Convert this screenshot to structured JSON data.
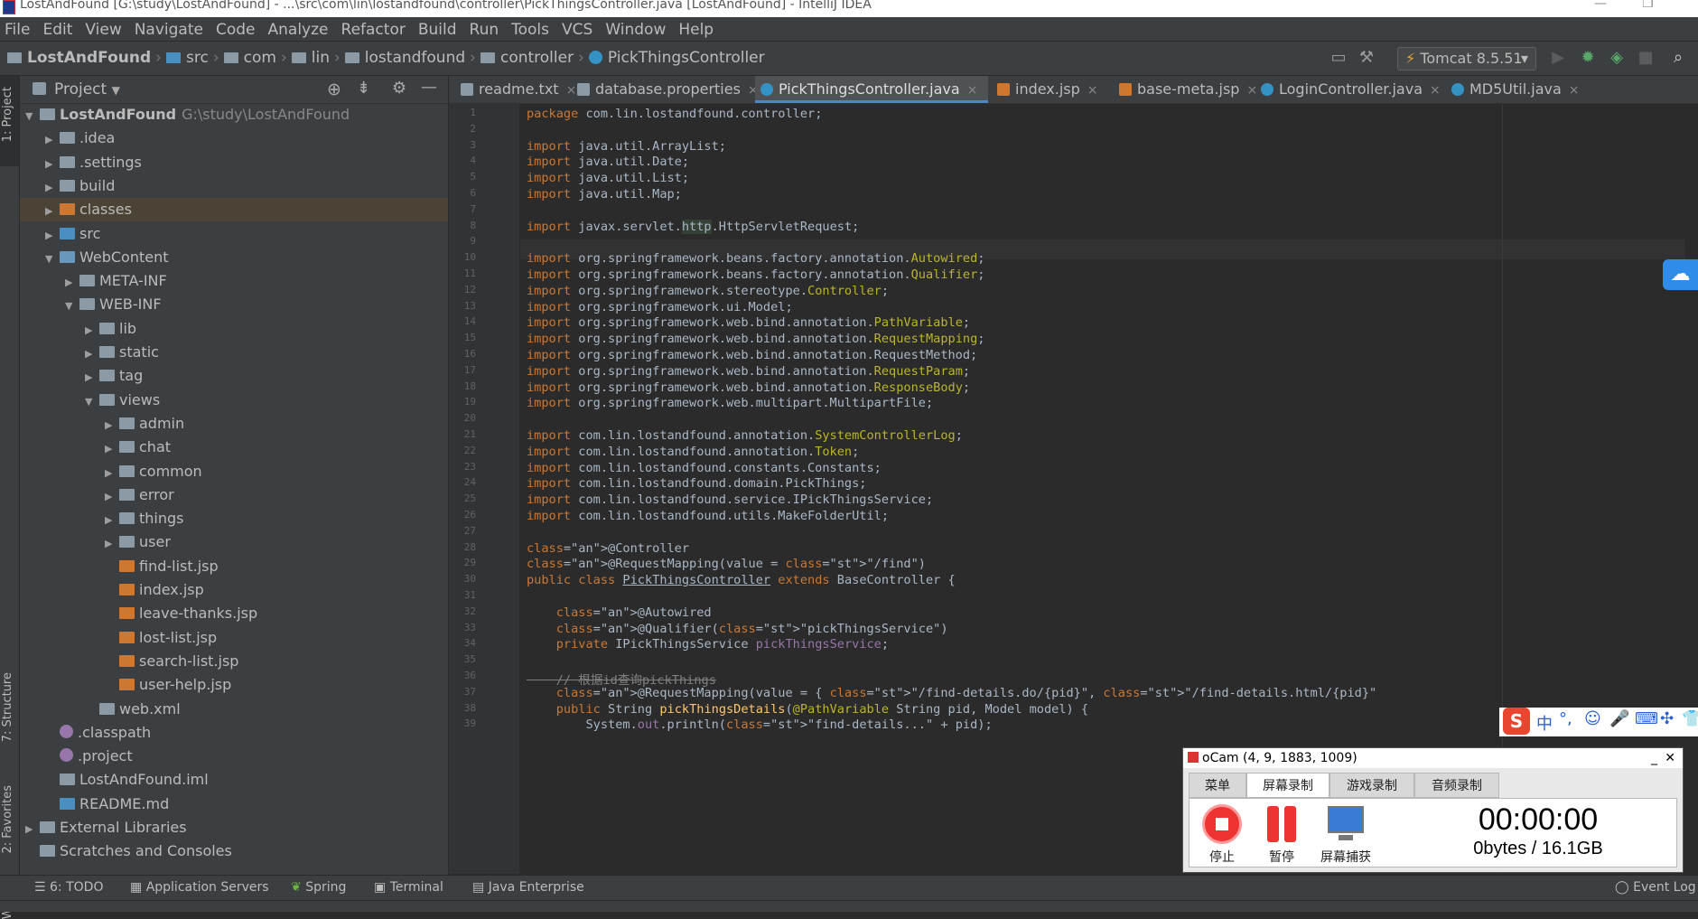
{
  "window": {
    "title": "LostAndFound [G:\\study\\LostAndFound] - ...\\src\\com\\lin\\lostandfound\\controller\\PickThingsController.java [LostAndFound] - IntelliJ IDEA"
  },
  "menu": [
    "File",
    "Edit",
    "View",
    "Navigate",
    "Code",
    "Analyze",
    "Refactor",
    "Build",
    "Run",
    "Tools",
    "VCS",
    "Window",
    "Help"
  ],
  "breadcrumb": [
    "LostAndFound",
    "src",
    "com",
    "lin",
    "lostandfound",
    "controller",
    "PickThingsController"
  ],
  "run_config": "Tomcat 8.5.51",
  "left_strip": {
    "project": "1: Project",
    "structure": "7: Structure",
    "favorites": "2: Favorites",
    "web": "Web"
  },
  "project_panel": {
    "title": "Project",
    "tree": [
      {
        "label": "LostAndFound",
        "path": "G:\\study\\LostAndFound",
        "depth": 0,
        "arrow": "▼",
        "icon": "module"
      },
      {
        "label": ".idea",
        "depth": 1,
        "arrow": "▶",
        "icon": "folder"
      },
      {
        "label": ".settings",
        "depth": 1,
        "arrow": "▶",
        "icon": "folder"
      },
      {
        "label": "build",
        "depth": 1,
        "arrow": "▶",
        "icon": "folder"
      },
      {
        "label": "classes",
        "depth": 1,
        "arrow": "▶",
        "icon": "folder-orange",
        "selected": true
      },
      {
        "label": "src",
        "depth": 1,
        "arrow": "▶",
        "icon": "folder-blue"
      },
      {
        "label": "WebContent",
        "depth": 1,
        "arrow": "▼",
        "icon": "folder-web"
      },
      {
        "label": "META-INF",
        "depth": 2,
        "arrow": "▶",
        "icon": "folder"
      },
      {
        "label": "WEB-INF",
        "depth": 2,
        "arrow": "▼",
        "icon": "folder"
      },
      {
        "label": "lib",
        "depth": 3,
        "arrow": "▶",
        "icon": "folder"
      },
      {
        "label": "static",
        "depth": 3,
        "arrow": "▶",
        "icon": "folder"
      },
      {
        "label": "tag",
        "depth": 3,
        "arrow": "▶",
        "icon": "folder"
      },
      {
        "label": "views",
        "depth": 3,
        "arrow": "▼",
        "icon": "folder"
      },
      {
        "label": "admin",
        "depth": 4,
        "arrow": "▶",
        "icon": "folder"
      },
      {
        "label": "chat",
        "depth": 4,
        "arrow": "▶",
        "icon": "folder"
      },
      {
        "label": "common",
        "depth": 4,
        "arrow": "▶",
        "icon": "folder"
      },
      {
        "label": "error",
        "depth": 4,
        "arrow": "▶",
        "icon": "folder"
      },
      {
        "label": "things",
        "depth": 4,
        "arrow": "▶",
        "icon": "folder"
      },
      {
        "label": "user",
        "depth": 4,
        "arrow": "▶",
        "icon": "folder"
      },
      {
        "label": "find-list.jsp",
        "depth": 4,
        "arrow": "",
        "icon": "jsp"
      },
      {
        "label": "index.jsp",
        "depth": 4,
        "arrow": "",
        "icon": "jsp"
      },
      {
        "label": "leave-thanks.jsp",
        "depth": 4,
        "arrow": "",
        "icon": "jsp"
      },
      {
        "label": "lost-list.jsp",
        "depth": 4,
        "arrow": "",
        "icon": "jsp"
      },
      {
        "label": "search-list.jsp",
        "depth": 4,
        "arrow": "",
        "icon": "jsp"
      },
      {
        "label": "user-help.jsp",
        "depth": 4,
        "arrow": "",
        "icon": "jsp"
      },
      {
        "label": "web.xml",
        "depth": 3,
        "arrow": "",
        "icon": "xml"
      },
      {
        "label": ".classpath",
        "depth": 1,
        "arrow": "",
        "icon": "cfg"
      },
      {
        "label": ".project",
        "depth": 1,
        "arrow": "",
        "icon": "cfg"
      },
      {
        "label": "LostAndFound.iml",
        "depth": 1,
        "arrow": "",
        "icon": "iml"
      },
      {
        "label": "README.md",
        "depth": 1,
        "arrow": "",
        "icon": "md"
      },
      {
        "label": "External Libraries",
        "depth": 0,
        "arrow": "▶",
        "icon": "lib"
      },
      {
        "label": "Scratches and Consoles",
        "depth": 0,
        "arrow": "",
        "icon": "scratch"
      }
    ]
  },
  "editor_tabs": [
    {
      "label": "readme.txt",
      "icon": "txt"
    },
    {
      "label": "database.properties",
      "icon": "props"
    },
    {
      "label": "PickThingsController.java",
      "icon": "class",
      "active": true
    },
    {
      "label": "index.jsp",
      "icon": "jsp"
    },
    {
      "label": "base-meta.jsp",
      "icon": "jsp"
    },
    {
      "label": "LoginController.java",
      "icon": "class"
    },
    {
      "label": "MD5Util.java",
      "icon": "class"
    }
  ],
  "code_lines": [
    {
      "n": "1",
      "t": "package com.lin.lostandfound.controller;"
    },
    {
      "n": "2",
      "t": ""
    },
    {
      "n": "3",
      "t": "import java.util.ArrayList;"
    },
    {
      "n": "4",
      "t": "import java.util.Date;"
    },
    {
      "n": "5",
      "t": "import java.util.List;"
    },
    {
      "n": "6",
      "t": "import java.util.Map;"
    },
    {
      "n": "7",
      "t": ""
    },
    {
      "n": "8",
      "t": "import javax.servlet.http.HttpServletRequest;"
    },
    {
      "n": "9",
      "t": ""
    },
    {
      "n": "10",
      "t": "import org.springframework.beans.factory.annotation.Autowired;"
    },
    {
      "n": "11",
      "t": "import org.springframework.beans.factory.annotation.Qualifier;"
    },
    {
      "n": "12",
      "t": "import org.springframework.stereotype.Controller;"
    },
    {
      "n": "13",
      "t": "import org.springframework.ui.Model;"
    },
    {
      "n": "14",
      "t": "import org.springframework.web.bind.annotation.PathVariable;"
    },
    {
      "n": "15",
      "t": "import org.springframework.web.bind.annotation.RequestMapping;"
    },
    {
      "n": "16",
      "t": "import org.springframework.web.bind.annotation.RequestMethod;"
    },
    {
      "n": "17",
      "t": "import org.springframework.web.bind.annotation.RequestParam;"
    },
    {
      "n": "18",
      "t": "import org.springframework.web.bind.annotation.ResponseBody;"
    },
    {
      "n": "19",
      "t": "import org.springframework.web.multipart.MultipartFile;"
    },
    {
      "n": "20",
      "t": ""
    },
    {
      "n": "21",
      "t": "import com.lin.lostandfound.annotation.SystemControllerLog;"
    },
    {
      "n": "22",
      "t": "import com.lin.lostandfound.annotation.Token;"
    },
    {
      "n": "23",
      "t": "import com.lin.lostandfound.constants.Constants;"
    },
    {
      "n": "24",
      "t": "import com.lin.lostandfound.domain.PickThings;"
    },
    {
      "n": "25",
      "t": "import com.lin.lostandfound.service.IPickThingsService;"
    },
    {
      "n": "26",
      "t": "import com.lin.lostandfound.utils.MakeFolderUtil;"
    },
    {
      "n": "27",
      "t": ""
    },
    {
      "n": "28",
      "t": "@Controller"
    },
    {
      "n": "29",
      "t": "@RequestMapping(value = \"/find\")"
    },
    {
      "n": "30",
      "t": "public class PickThingsController extends BaseController {"
    },
    {
      "n": "31",
      "t": ""
    },
    {
      "n": "32",
      "t": "    @Autowired"
    },
    {
      "n": "33",
      "t": "    @Qualifier(\"pickThingsService\")"
    },
    {
      "n": "34",
      "t": "    private IPickThingsService pickThingsService;"
    },
    {
      "n": "35",
      "t": ""
    },
    {
      "n": "36",
      "t": "    // 根据id查询pickThings"
    },
    {
      "n": "37",
      "t": "    @RequestMapping(value = { \"/find-details.do/{pid}\", \"/find-details.html/{pid}\""
    },
    {
      "n": "38",
      "t": "    public String pickThingsDetails(@PathVariable String pid, Model model) {"
    },
    {
      "n": "39",
      "t": "        System.out.println(\"find-details...\" + pid);"
    }
  ],
  "bottom_tools": [
    "6: TODO",
    "Application Servers",
    "Spring",
    "Terminal",
    "Java Enterprise"
  ],
  "event_log": "Event Log",
  "ocam": {
    "title": "oCam (4, 9, 1883, 1009)",
    "tabs": [
      "菜单",
      "屏幕录制",
      "游戏录制",
      "音频录制"
    ],
    "buttons": [
      "停止",
      "暂停",
      "屏幕捕获"
    ],
    "time": "00:00:00",
    "size": "0bytes / 16.1GB"
  },
  "ime": {
    "lang": "中"
  },
  "colors": {
    "accent": "#4a88c7",
    "selected_row": "#4b4436",
    "editor_bg": "#2b2b2b",
    "panel_bg": "#3c3f41"
  }
}
